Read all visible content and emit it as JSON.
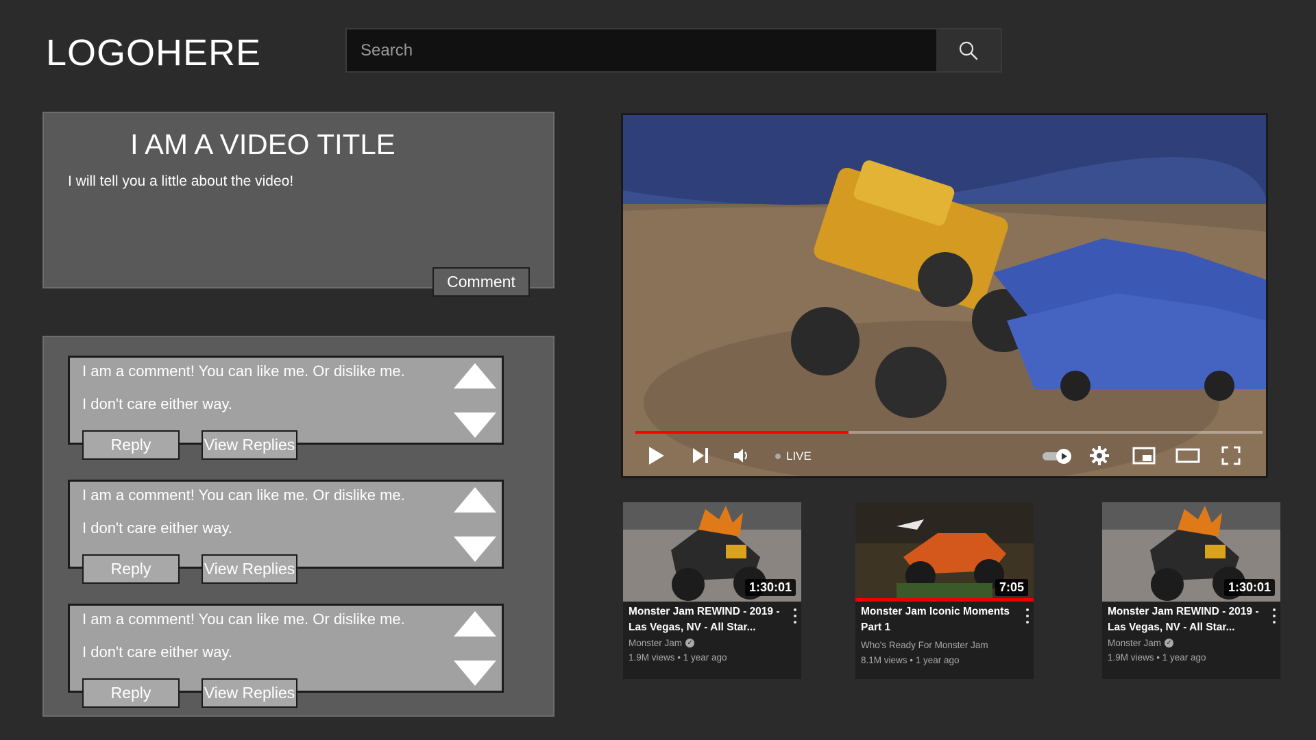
{
  "header": {
    "logo": "LOGOHERE",
    "search_placeholder": "Search",
    "search_icon": "search-icon"
  },
  "video_info": {
    "title": "I AM A VIDEO TITLE",
    "description": "I will tell you a little about the video!",
    "comment_button": "Comment"
  },
  "comments": [
    {
      "line1": "I am a comment!  You can like me.  Or dislike me.",
      "line2": "I don't care either way.",
      "reply_label": "Reply",
      "view_replies_label": "View Replies"
    },
    {
      "line1": "I am a comment!  You can like me.  Or dislike me.",
      "line2": "I don't care either way.",
      "reply_label": "Reply",
      "view_replies_label": "View Replies"
    },
    {
      "line1": "I am a comment!  You can like me.  Or dislike me.",
      "line2": "I don't care either way.",
      "reply_label": "Reply",
      "view_replies_label": "View Replies"
    }
  ],
  "player": {
    "progress": 0.34,
    "live_label": "LIVE",
    "accent_color": "#ff0000",
    "icons": [
      "play-icon",
      "next-icon",
      "volume-icon",
      "autoplay-toggle-icon",
      "settings-icon",
      "miniplayer-icon",
      "theater-icon",
      "fullscreen-icon"
    ]
  },
  "recommended": [
    {
      "title": "Monster Jam REWIND - 2019 - Las Vegas, NV - All Star...",
      "channel": "Monster Jam",
      "verified": true,
      "meta": "1.9M views • 1 year ago",
      "duration": "1:30:01"
    },
    {
      "title": "Monster Jam Iconic Moments Part 1",
      "channel": "Who's Ready For Monster Jam",
      "verified": false,
      "meta": "8.1M views • 1 year ago",
      "duration": "7:05"
    },
    {
      "title": "Monster Jam REWIND - 2019 - Las Vegas, NV - All Star...",
      "channel": "Monster Jam",
      "verified": true,
      "meta": "1.9M views • 1 year ago",
      "duration": "1:30:01"
    }
  ]
}
